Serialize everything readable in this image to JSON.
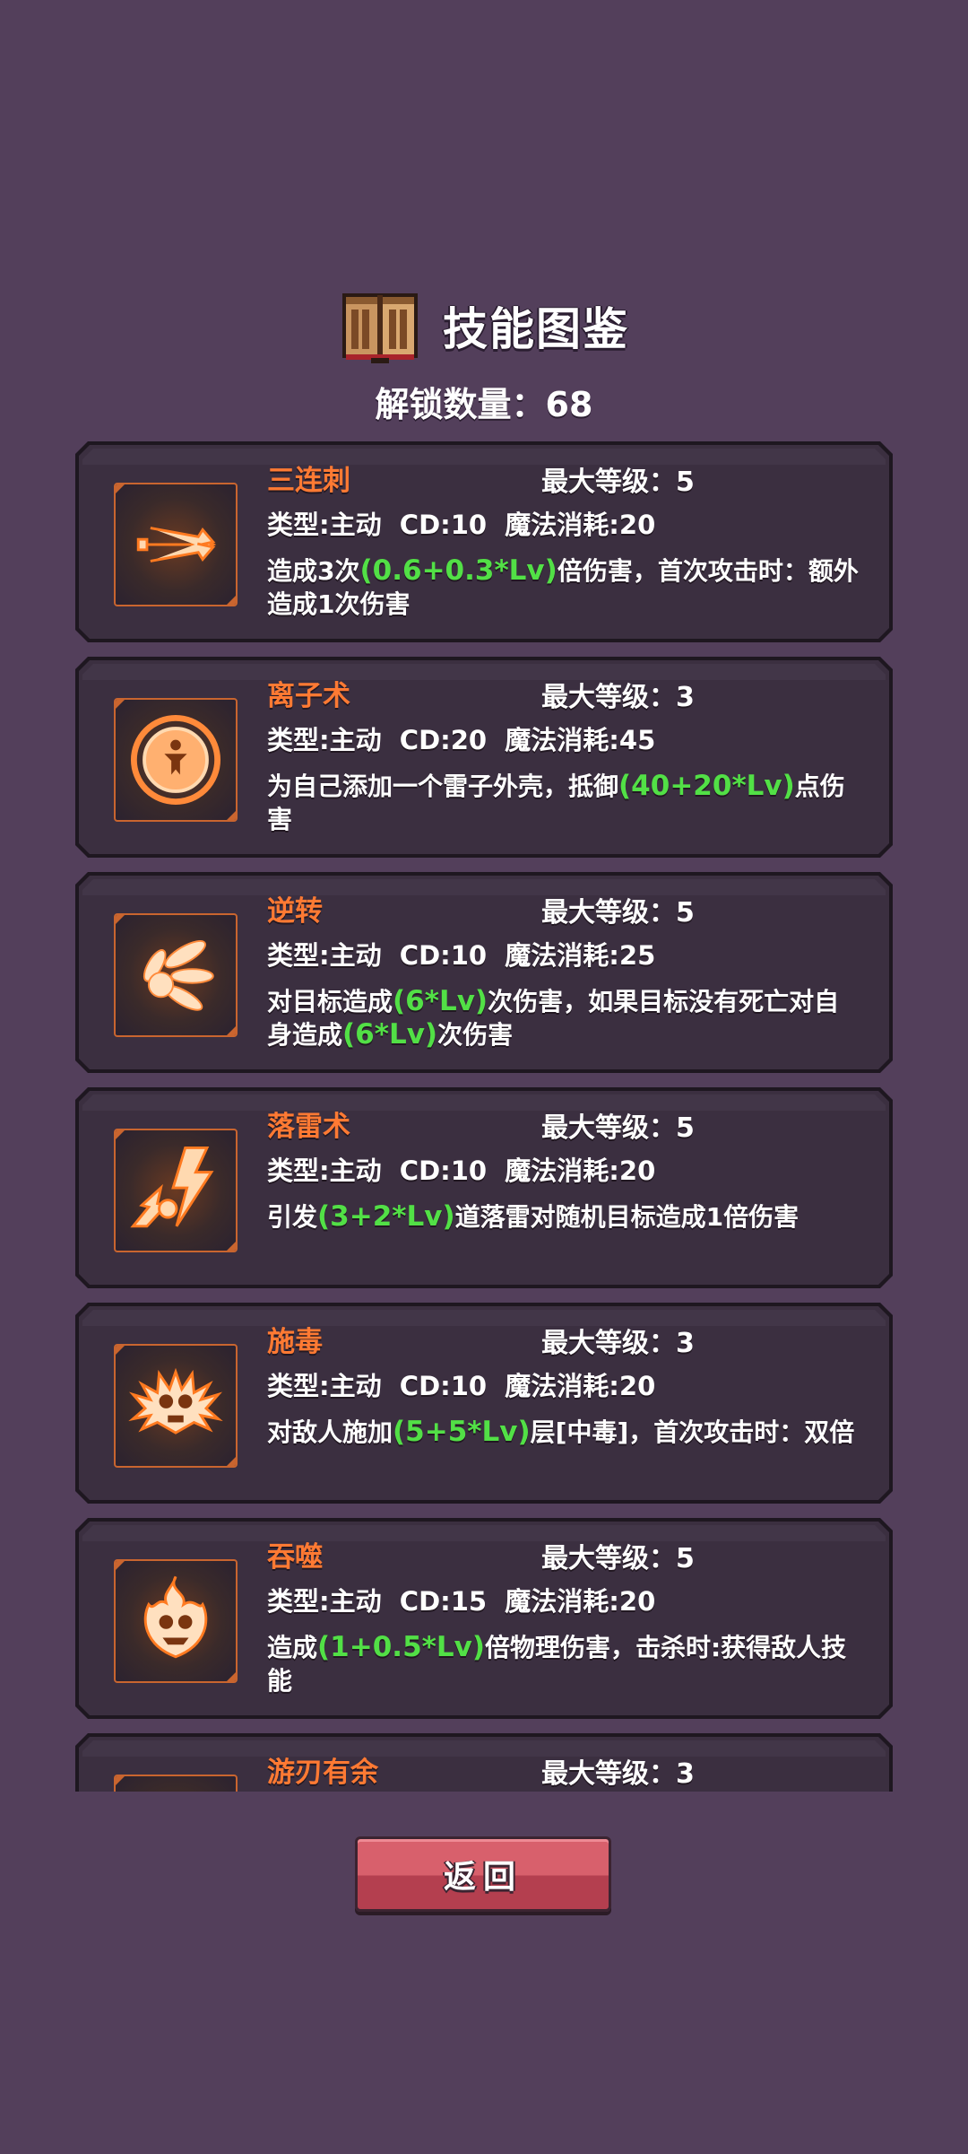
{
  "header": {
    "title": "技能图鉴",
    "unlock_text": "解锁数量：68"
  },
  "skills": [
    {
      "name": "三连刺",
      "max_level": "最大等级：5",
      "meta": "类型:主动  CD:10  魔法消耗:20",
      "desc": [
        {
          "t": "造成3次",
          "hl": false
        },
        {
          "t": "(0.6+0.3*Lv)",
          "hl": true
        },
        {
          "t": "倍伤害，首次攻击时：额外造成1次伤害",
          "hl": false
        }
      ],
      "icon": "triple-strike-icon"
    },
    {
      "name": "离子术",
      "max_level": "最大等级：3",
      "meta": "类型:主动  CD:20  魔法消耗:45",
      "desc": [
        {
          "t": "为自己添加一个雷子外壳，抵御",
          "hl": false
        },
        {
          "t": "(40+20*Lv)",
          "hl": true
        },
        {
          "t": "点伤害",
          "hl": false
        }
      ],
      "icon": "ion-shield-icon"
    },
    {
      "name": "逆转",
      "max_level": "最大等级：5",
      "meta": "类型:主动  CD:10  魔法消耗:25",
      "desc": [
        {
          "t": "对目标造成",
          "hl": false
        },
        {
          "t": "(6*Lv)",
          "hl": true
        },
        {
          "t": "次伤害，如果目标没有死亡对自身造成",
          "hl": false
        },
        {
          "t": "(6*Lv)",
          "hl": true
        },
        {
          "t": "次伤害",
          "hl": false
        }
      ],
      "icon": "reversal-icon"
    },
    {
      "name": "落雷术",
      "max_level": "最大等级：5",
      "meta": "类型:主动  CD:10  魔法消耗:20",
      "desc": [
        {
          "t": "引发",
          "hl": false
        },
        {
          "t": "(3+2*Lv)",
          "hl": true
        },
        {
          "t": "道落雷对随机目标造成1倍伤害",
          "hl": false
        }
      ],
      "icon": "lightning-icon"
    },
    {
      "name": "施毒",
      "max_level": "最大等级：3",
      "meta": "类型:主动  CD:10  魔法消耗:20",
      "desc": [
        {
          "t": "对敌人施加",
          "hl": false
        },
        {
          "t": "(5+5*Lv)",
          "hl": true
        },
        {
          "t": "层[中毒]，首次攻击时：双倍",
          "hl": false
        }
      ],
      "icon": "poison-skull-icon"
    },
    {
      "name": "吞噬",
      "max_level": "最大等级：5",
      "meta": "类型:主动  CD:15  魔法消耗:20",
      "desc": [
        {
          "t": "造成",
          "hl": false
        },
        {
          "t": "(1+0.5*Lv)",
          "hl": true
        },
        {
          "t": "倍物理伤害，击杀时:获得敌人技能",
          "hl": false
        }
      ],
      "icon": "devour-flame-icon"
    },
    {
      "name": "游刃有余",
      "max_level": "最大等级：3",
      "meta": "",
      "desc": [],
      "icon": "blade-icon"
    }
  ],
  "back_button": {
    "label": "返回"
  },
  "colors": {
    "background": "#533f5b",
    "card": "#3b2f40",
    "skill_name": "#ff7a33",
    "formula": "#52e046",
    "button": "#d8606c"
  }
}
